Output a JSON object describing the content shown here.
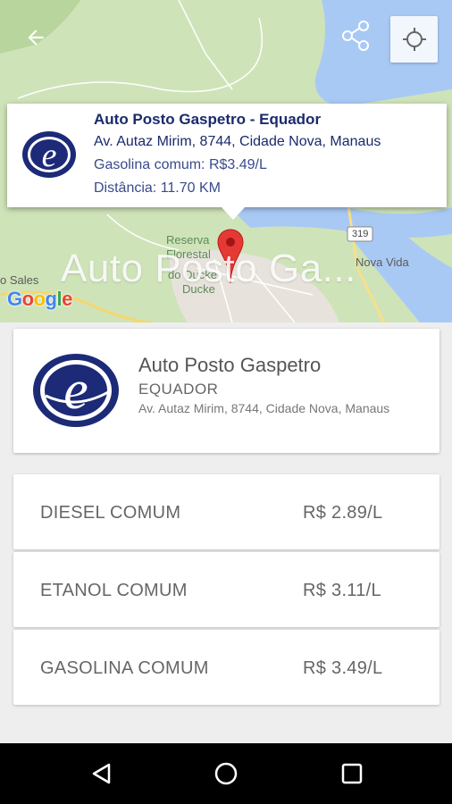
{
  "map": {
    "title_overlay": "Auto Posto Ga...",
    "labels": {
      "reserva": "Reserva",
      "florestal": "Florestal",
      "adolpho": "do Ducke",
      "ducke": "Ducke",
      "sales": "o Sales",
      "nova_vida": "Nova Vida",
      "route": "319"
    },
    "google_letters": [
      "G",
      "o",
      "o",
      "g",
      "l",
      "e"
    ]
  },
  "info_window": {
    "name": "Auto Posto Gaspetro - Equador",
    "address": "Av. Autaz Mirim, 8744, Cidade Nova, Manaus",
    "price": "Gasolina comum: R$3.49/L",
    "distance": "Distância: 11.70 KM"
  },
  "station": {
    "name": "Auto Posto Gaspetro",
    "area": "EQUADOR",
    "address": "Av. Autaz Mirim, 8744, Cidade Nova, Manaus"
  },
  "fuels": [
    {
      "name": "DIESEL COMUM",
      "price": "R$ 2.89/L"
    },
    {
      "name": "ETANOL COMUM",
      "price": "R$ 3.11/L"
    },
    {
      "name": "GASOLINA COMUM",
      "price": "R$ 3.49/L"
    }
  ],
  "colors": {
    "brand_navy": "#1a2a6c",
    "marker_red": "#e53935",
    "map_green": "#c9dfb3",
    "map_water": "#a9c9f5"
  }
}
